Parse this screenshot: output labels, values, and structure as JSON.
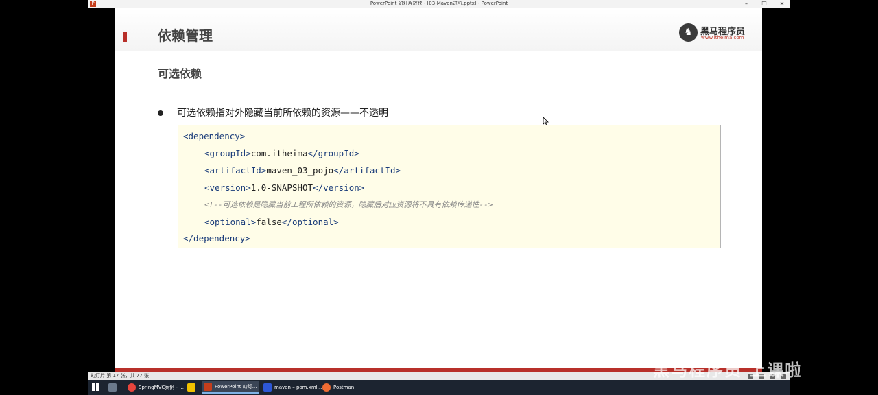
{
  "window": {
    "title": "PowerPoint 幻灯片放映 - [03-Maven进阶.pptx] - PowerPoint",
    "controls": [
      "–",
      "❐",
      "✕"
    ]
  },
  "slide": {
    "title": "依赖管理",
    "logo": {
      "name": "黑马程序员",
      "url": "www.itheima.com"
    },
    "subtitle": "可选依赖",
    "bullet": "可选依赖指对外隐藏当前所依赖的资源——不透明",
    "code": {
      "l1_open": "<dependency>",
      "l2_open": "<groupId>",
      "l2_value": "com.itheima",
      "l2_close": "</groupId>",
      "l3_open": "<artifactId>",
      "l3_value": "maven_03_pojo",
      "l3_close": "</artifactId>",
      "l4_open": "<version>",
      "l4_value": "1.0-SNAPSHOT",
      "l4_close": "</version>",
      "l5_comment": "<!--可选依赖是隐藏当前工程所依赖的资源，隐藏后对应资源将不具有依赖传递性-->",
      "l6_open": "<optional>",
      "l6_value": "false",
      "l6_close": "</optional>",
      "l7_close": "</dependency>"
    }
  },
  "statusbar": {
    "text": "幻灯片 第 17 张，共 77 张"
  },
  "watermark": "黑马程序员 上课啦",
  "taskbar": {
    "items": [
      {
        "label": "SpringMVC案例 - ...",
        "color": "#e8453c"
      },
      {
        "label": "",
        "color": "#f2c200"
      },
      {
        "label": "PowerPoint 幻灯...",
        "color": "#c43e1c"
      },
      {
        "label": "maven – pom.xml...",
        "color": "#2d57d6"
      },
      {
        "label": "Postman",
        "color": "#ef6c33"
      }
    ]
  },
  "colors": {
    "accent": "#b8302a",
    "code_bg": "#fffde8",
    "tag": "#1a3c7a"
  }
}
